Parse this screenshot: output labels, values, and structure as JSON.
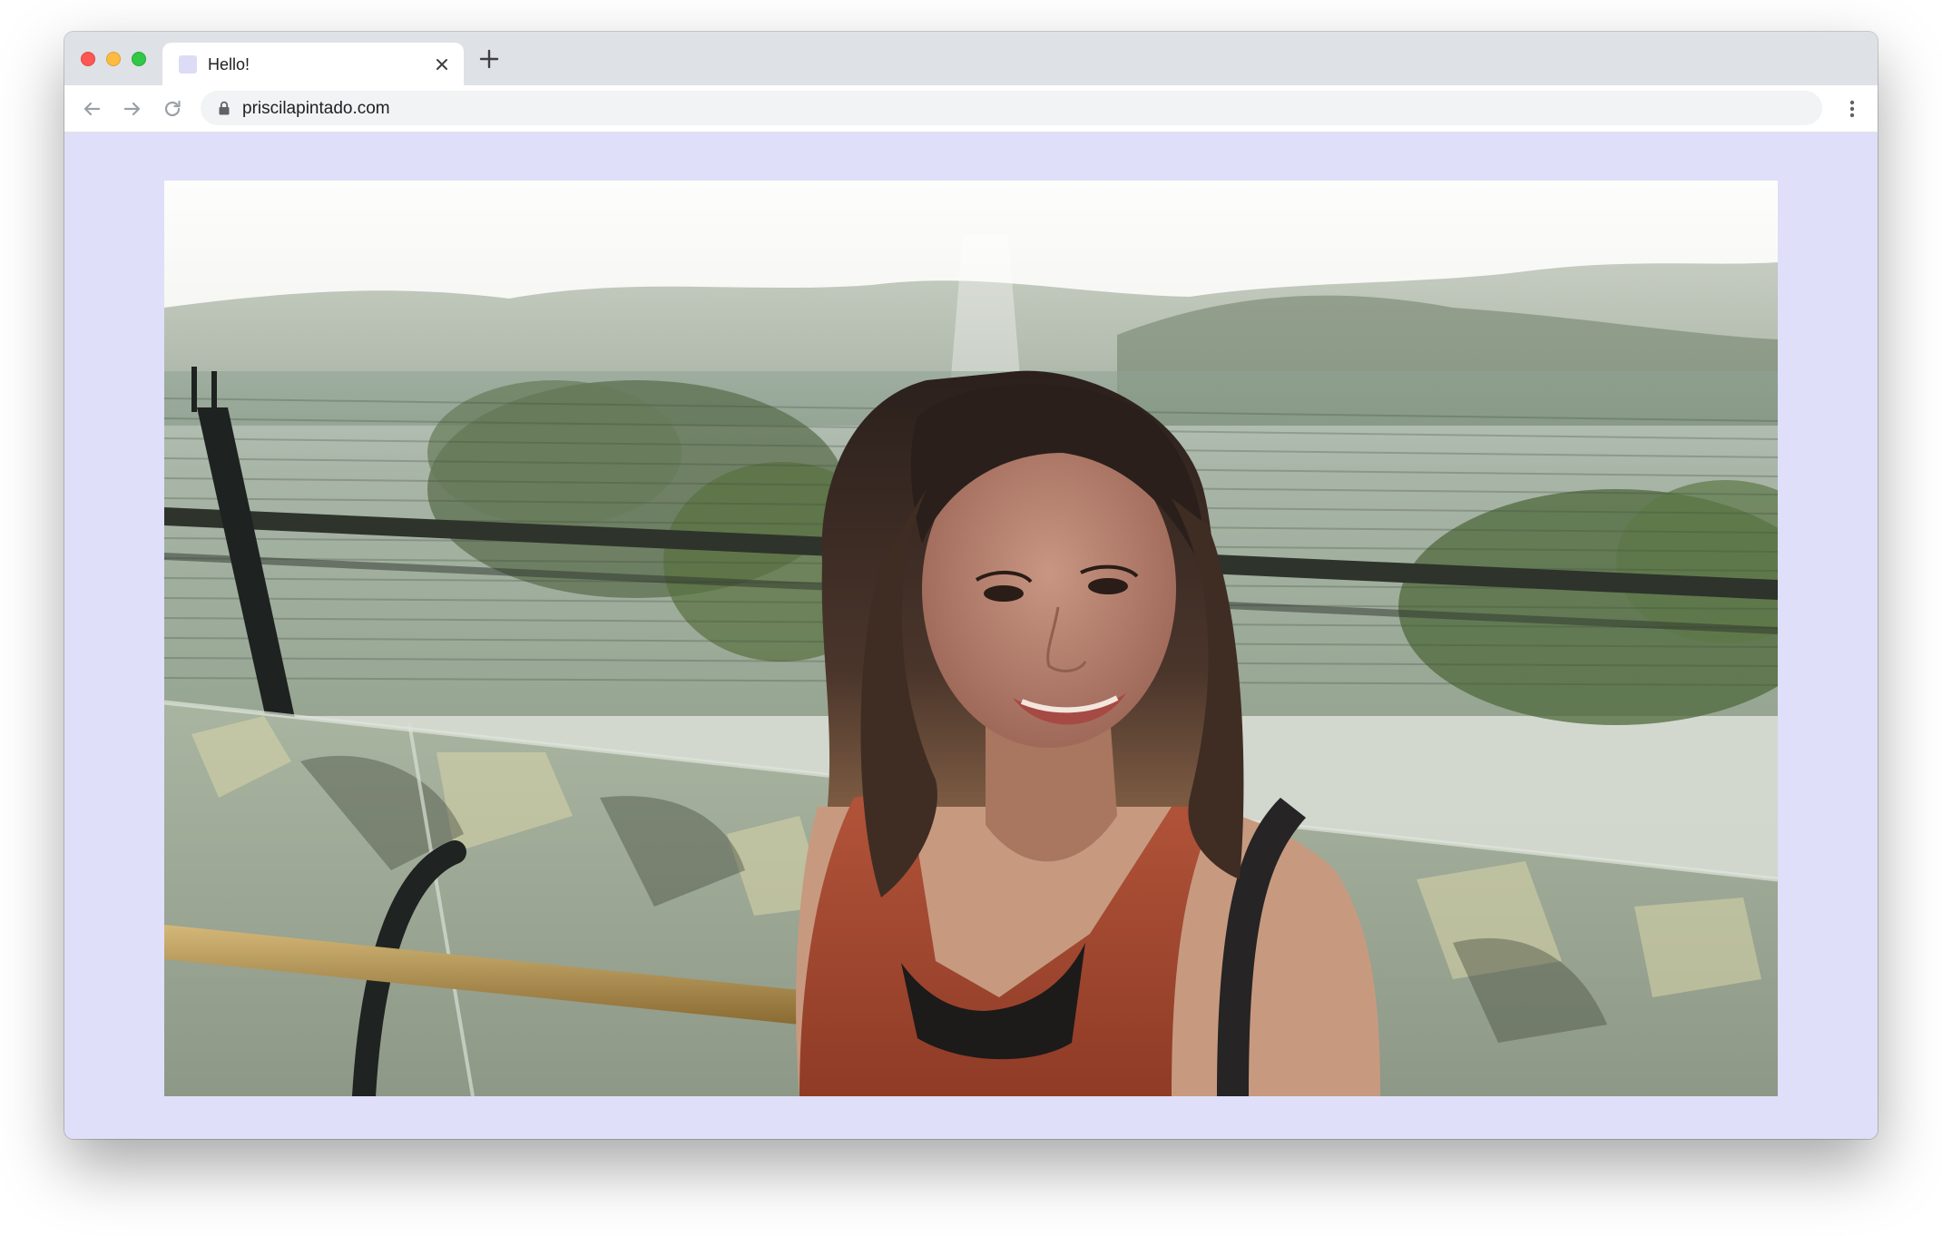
{
  "browser": {
    "tab": {
      "title": "Hello!",
      "favicon_color": "#dcdcf7"
    },
    "address_bar": {
      "url": "priscilapintado.com",
      "secure_icon": "lock-icon"
    },
    "icons": {
      "back": "arrow-left-icon",
      "forward": "arrow-right-icon",
      "reload": "reload-icon",
      "menu": "more-vertical-icon",
      "new_tab": "plus-icon",
      "close_tab": "close-icon"
    }
  },
  "page": {
    "background_color": "#dfdff9",
    "photo": {
      "description_type": "portrait-photo"
    }
  }
}
